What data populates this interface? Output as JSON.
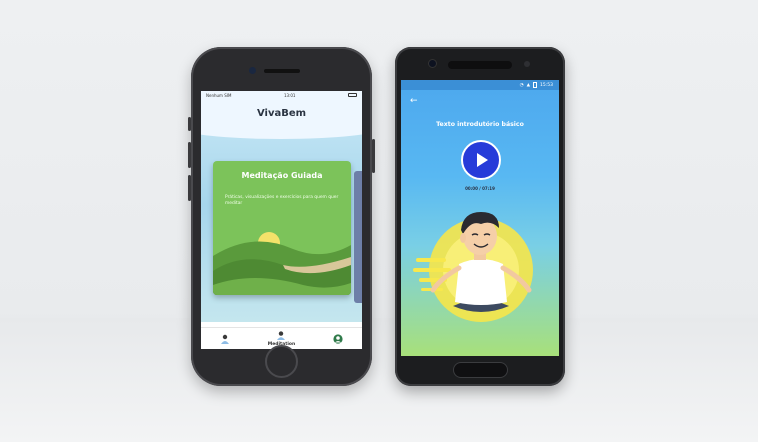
{
  "left_phone": {
    "status": {
      "carrier": "Nenhum SIM",
      "time": "13:01"
    },
    "app_title": "VivaBem",
    "card": {
      "title": "Meditação Guiada",
      "description": "Práticas, visualizações e exercícios para quem quer meditar"
    },
    "tabs": [
      {
        "label": "",
        "icon": "person-icon"
      },
      {
        "label": "Meditation",
        "icon": "meditation-icon"
      },
      {
        "label": "",
        "icon": "profile-icon"
      }
    ]
  },
  "right_phone": {
    "status": {
      "time": "15:53"
    },
    "lesson_title": "Texto introdutório básico",
    "playback_time": "00:00 / 07:19"
  },
  "colors": {
    "card_green": "#7cc35a",
    "play_blue": "#263bd9",
    "sky_blue": "#58b8f2"
  }
}
